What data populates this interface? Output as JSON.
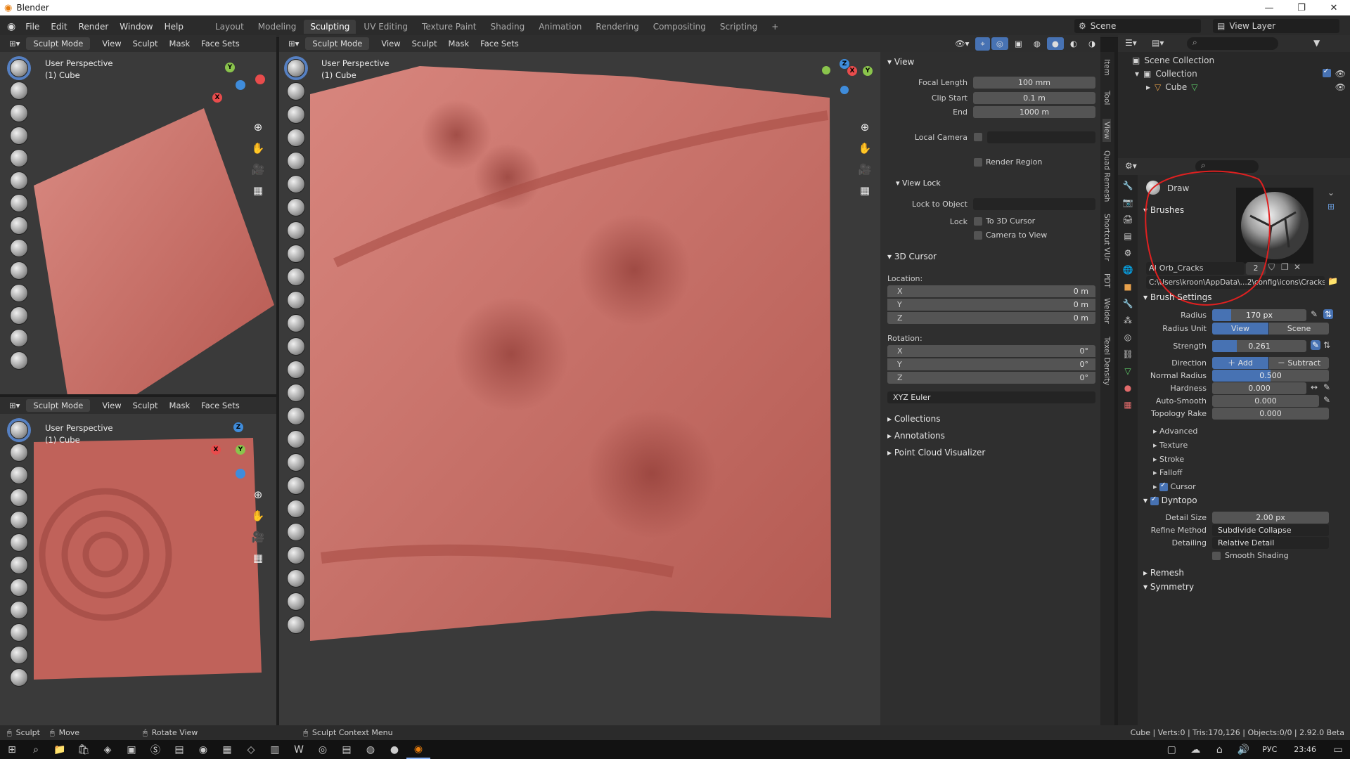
{
  "window": {
    "title": "Blender",
    "controls": [
      "—",
      "❐",
      "✕"
    ]
  },
  "topbar": {
    "menus": [
      "File",
      "Edit",
      "Render",
      "Window",
      "Help"
    ],
    "tabs": [
      "Layout",
      "Modeling",
      "Sculpting",
      "UV Editing",
      "Texture Paint",
      "Shading",
      "Animation",
      "Rendering",
      "Compositing",
      "Scripting"
    ],
    "active_tab": "Sculpting",
    "add_tab": "+",
    "scene_label": "Scene",
    "view_layer_label": "View Layer"
  },
  "viewport_header": {
    "mode": "Sculpt Mode",
    "items": [
      "View",
      "Sculpt",
      "Mask",
      "Face Sets"
    ]
  },
  "viewports": {
    "left_top": {
      "label1": "User Perspective",
      "label2": "(1) Cube"
    },
    "left_bottom": {
      "label1": "User Perspective",
      "label2": "(1) Cube"
    },
    "main": {
      "label1": "User Perspective",
      "label2": "(1) Cube"
    }
  },
  "gizmo": {
    "x": "X",
    "y": "Y",
    "z": "Z"
  },
  "npanel": {
    "tabs": [
      "Item",
      "Tool",
      "View",
      "Quad Remesh",
      "Shortcut VUr",
      "PDT",
      "Welder",
      "Texel Density"
    ],
    "view_title": "View",
    "focal_length_label": "Focal Length",
    "focal_length": "100 mm",
    "clip_start_label": "Clip Start",
    "clip_start": "0.1 m",
    "end_label": "End",
    "end": "1000 m",
    "local_camera_label": "Local Camera",
    "render_region_label": "Render Region",
    "view_lock_title": "View Lock",
    "lock_to_object_label": "Lock to Object",
    "lock_label": "Lock",
    "to_3d_cursor_label": "To 3D Cursor",
    "camera_to_view_label": "Camera to View",
    "cursor_title": "3D Cursor",
    "location_label": "Location:",
    "loc_x": "0 m",
    "loc_y": "0 m",
    "loc_z": "0 m",
    "rotation_label": "Rotation:",
    "rot_x": "0°",
    "rot_y": "0°",
    "rot_z": "0°",
    "x_label": "X",
    "y_label": "Y",
    "z_label": "Z",
    "rotation_mode": "XYZ Euler",
    "collections_label": "Collections",
    "annotations_label": "Annotations",
    "point_cloud_label": "Point Cloud Visualizer"
  },
  "outliner": {
    "scene_collection": "Scene Collection",
    "collection": "Collection",
    "cube": "Cube"
  },
  "properties": {
    "tool_name": "Draw",
    "brushes_title": "Brushes",
    "brush_name": "A| Orb_Cracks",
    "brush_users": "2",
    "brush_path": "C:\\Users\\kroon\\AppData\\...2\\config\\icons\\Cracks.png",
    "brush_settings_title": "Brush Settings",
    "radius_label": "Radius",
    "radius": "170 px",
    "radius_fill": 0.2,
    "radius_unit_label": "Radius Unit",
    "radius_unit_view": "View",
    "radius_unit_scene": "Scene",
    "strength_label": "Strength",
    "strength": "0.261",
    "strength_fill": 0.261,
    "direction_label": "Direction",
    "direction_add": "Add",
    "direction_subtract": "Subtract",
    "normal_radius_label": "Normal Radius",
    "normal_radius": "0.500",
    "normal_radius_fill": 0.5,
    "hardness_label": "Hardness",
    "hardness": "0.000",
    "auto_smooth_label": "Auto-Smooth",
    "auto_smooth": "0.000",
    "topology_rake_label": "Topology Rake",
    "topology_rake": "0.000",
    "sub_advanced": "Advanced",
    "sub_texture": "Texture",
    "sub_stroke": "Stroke",
    "sub_falloff": "Falloff",
    "sub_cursor": "Cursor",
    "dyntopo_title": "Dyntopo",
    "detail_size_label": "Detail Size",
    "detail_size": "2.00 px",
    "refine_method_label": "Refine Method",
    "refine_method": "Subdivide Collapse",
    "detailing_label": "Detailing",
    "detailing": "Relative Detail",
    "smooth_shading_label": "Smooth Shading",
    "remesh_title": "Remesh",
    "symmetry_title": "Symmetry"
  },
  "statusbar": {
    "sculpt": "Sculpt",
    "move": "Move",
    "rotate": "Rotate View",
    "context": "Sculpt Context Menu",
    "stats": "Cube | Verts:0 | Tris:170,126 | Objects:0/0 | 2.92.0 Beta"
  },
  "taskbar": {
    "lang": "РУС",
    "time": "23:46"
  },
  "colors": {
    "accent": "#4772b3",
    "annotation": "#e02020",
    "mesh": "#c9706a"
  }
}
